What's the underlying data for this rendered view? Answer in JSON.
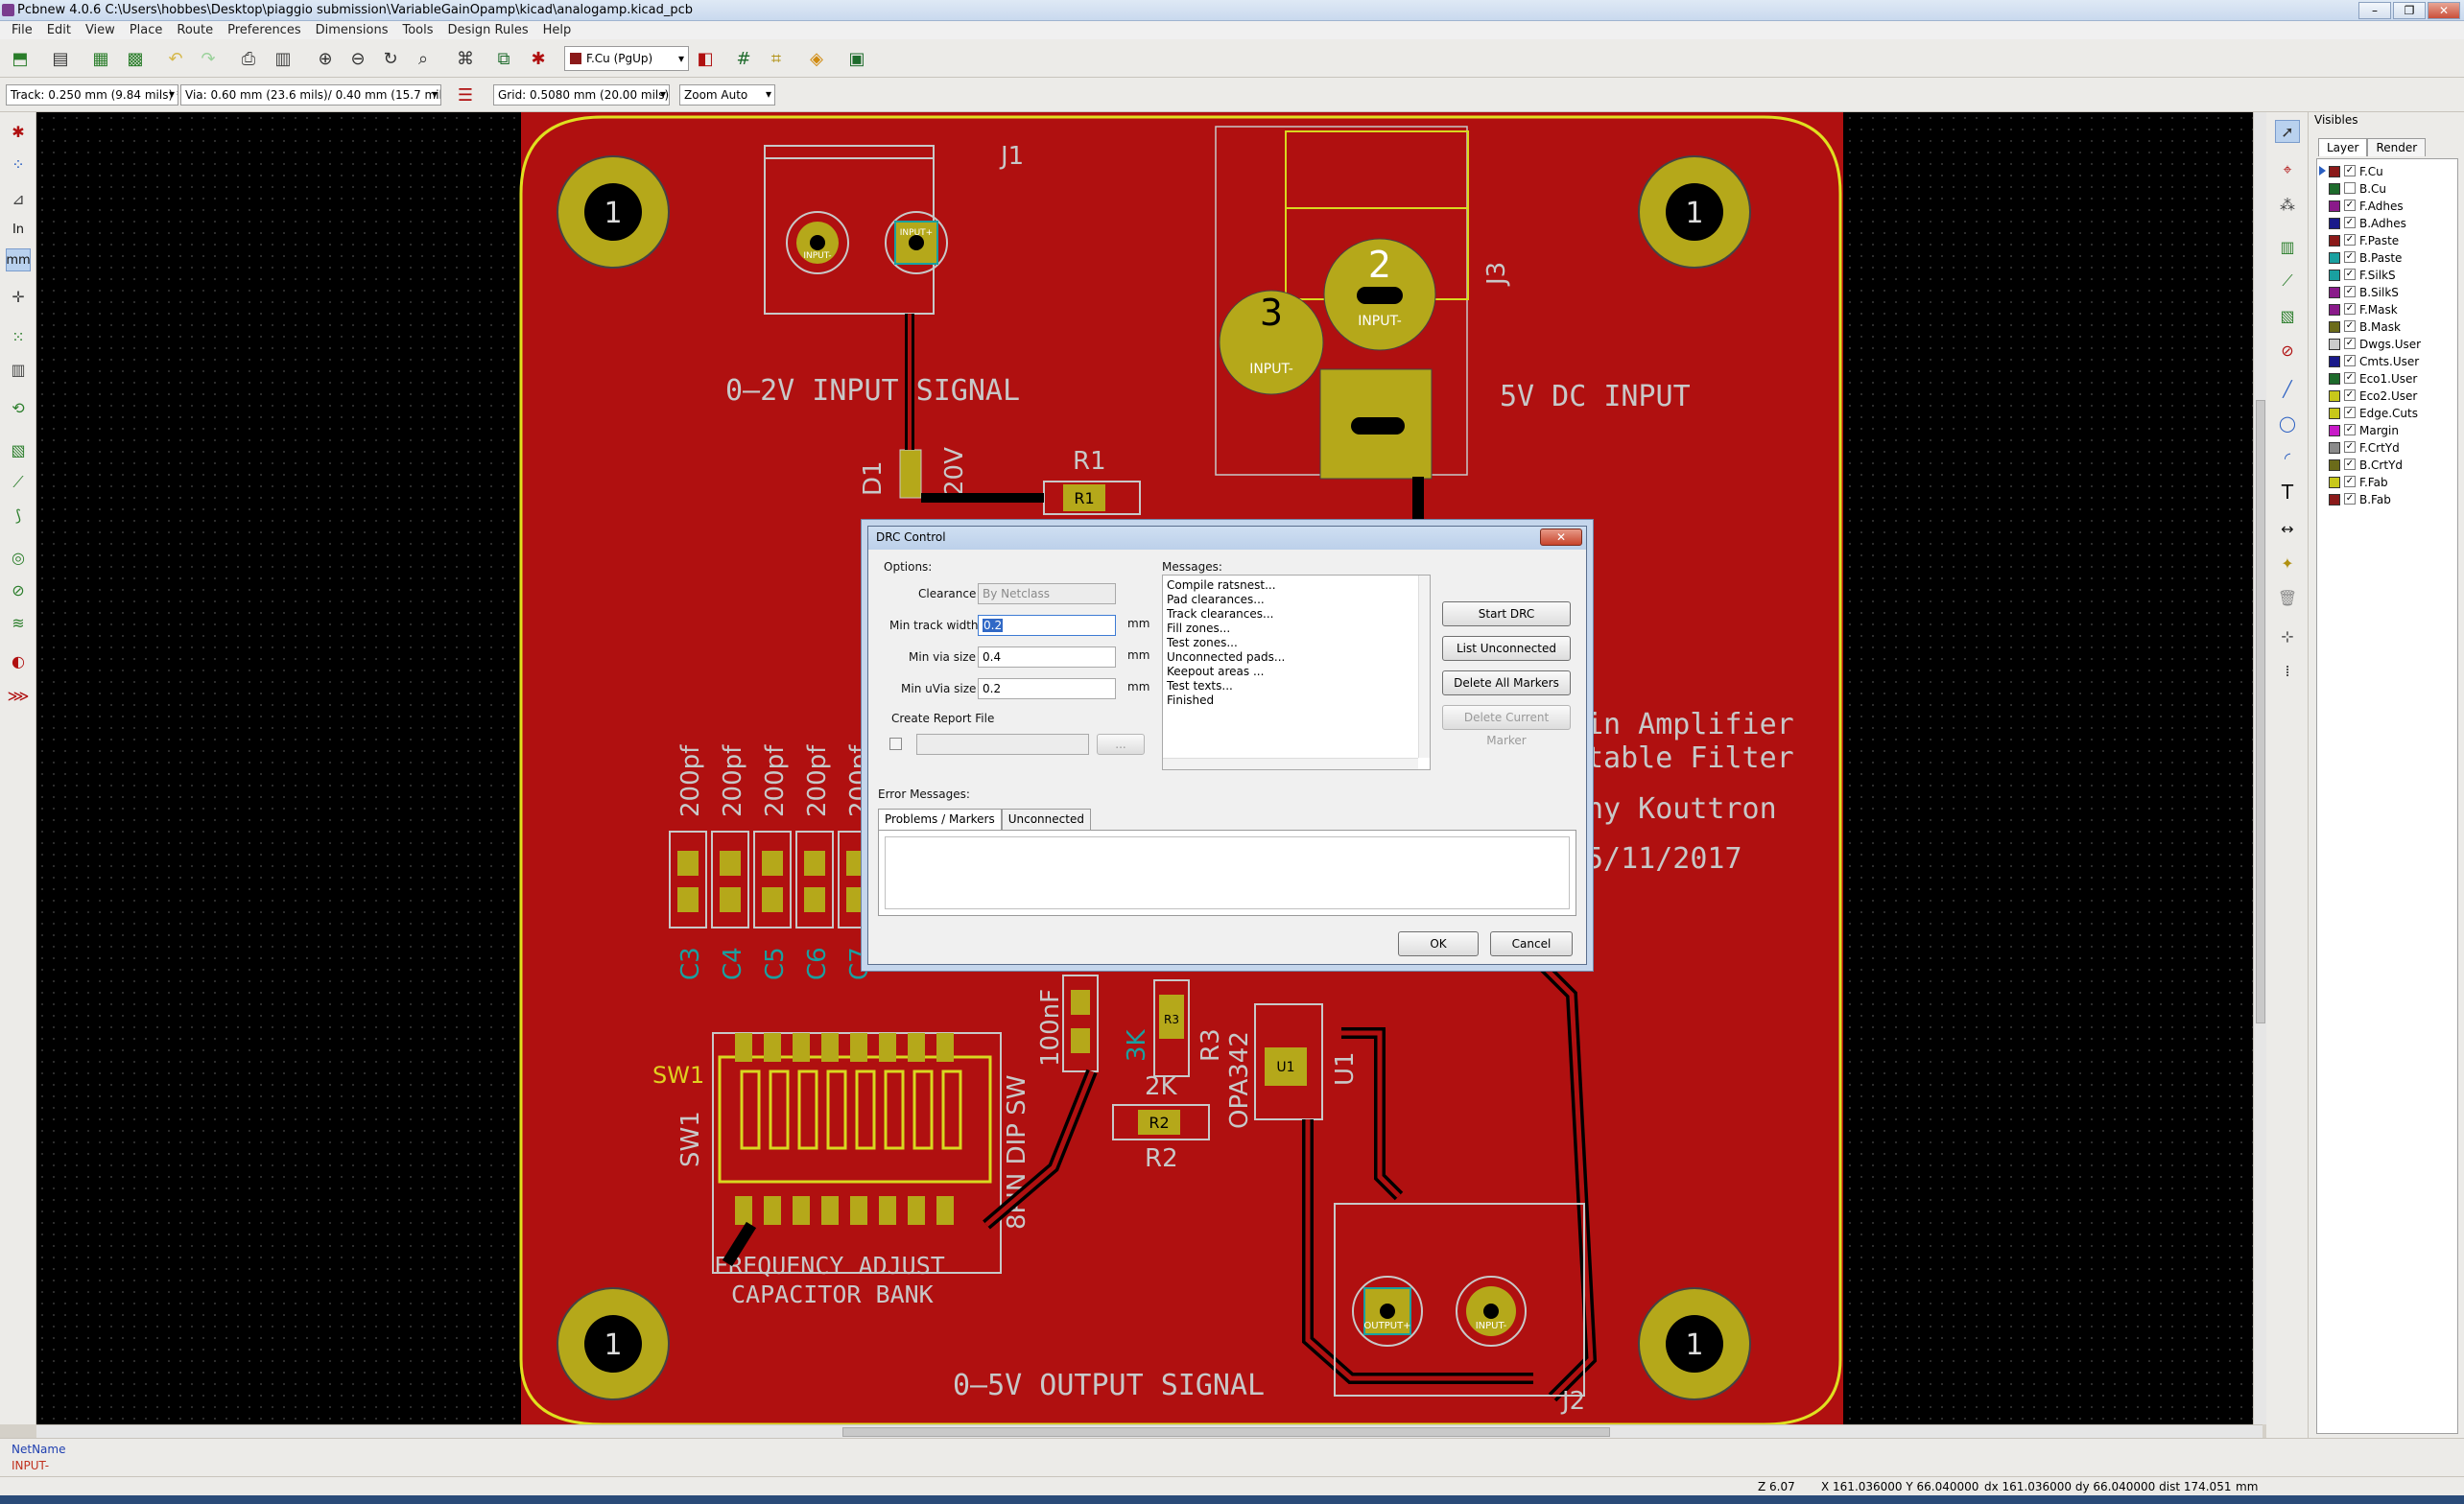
{
  "window": {
    "title": "Pcbnew 4.0.6 C:\\Users\\hobbes\\Desktop\\piaggio submission\\VariableGainOpamp\\kicad\\analogamp.kicad_pcb",
    "buttons": [
      "–",
      "❐",
      "✕"
    ]
  },
  "menu": [
    "File",
    "Edit",
    "View",
    "Place",
    "Route",
    "Preferences",
    "Dimensions",
    "Tools",
    "Design Rules",
    "Help"
  ],
  "toolbar": {
    "layer_select": "F.Cu (PgUp)",
    "track_combo": "Track: 0.250 mm (9.84 mils) *",
    "via_combo": "Via: 0.60 mm (23.6 mils)/ 0.40 mm (15.7 mils) *",
    "grid_combo": "Grid: 0.5080 mm (20.00 mils)",
    "zoom_combo": "Zoom Auto",
    "units_in": "In",
    "units_mm": "mm"
  },
  "pcb": {
    "labels": {
      "j1": "J1",
      "input_signal": "0–2V INPUT SIGNAL",
      "dc_input": "5V DC INPUT",
      "j3": "J3",
      "r1": "R1",
      "d1": "D1",
      "d1_val": "20V",
      "title1": "in Amplifier",
      "title2": "table Filter",
      "author": "hy Kouttron",
      "date": "5/11/2017",
      "sw1_yellow": "SW1",
      "sw1": "SW1",
      "dip_sw": "8PIN DIP SW",
      "freq1": "FREQUENCY ADJUST",
      "freq2": "CAPACITOR BANK",
      "output": "0–5V OUTPUT SIGNAL",
      "j2": "J2",
      "r2": "R2",
      "r2_val": "2K",
      "r3": "R3",
      "r3_val": "3K",
      "cap_val": "100nF",
      "u1": "U1",
      "u1_val": "OPA342",
      "pad_r1": "R1",
      "pad_r2": "R2",
      "pad_r3": "R3",
      "pad_u1": "U1",
      "pad_input_minus": "INPUT-",
      "pad_input_plus": "INPUT+",
      "pad_output_plus": "OUTPUT+",
      "pad_j3_input_minus": "INPUT-",
      "mount_hole": "1"
    },
    "cap_values": [
      "200pf",
      "200pf",
      "200pf",
      "200pf",
      "200pf"
    ],
    "cap_refs": [
      "C3",
      "C4",
      "C5",
      "C6",
      "C7"
    ],
    "pin_numbers": [
      "1",
      "2",
      "3"
    ]
  },
  "dialog": {
    "title": "DRC Control",
    "options_label": "Options:",
    "messages_label": "Messages:",
    "clearance_label": "Clearance",
    "clearance_value": "By Netclass",
    "min_track_label": "Min track width",
    "min_track_value": "0.2",
    "min_via_label": "Min via size",
    "min_via_value": "0.4",
    "min_uvia_label": "Min uVia size",
    "min_uvia_value": "0.2",
    "unit": "mm",
    "report_label": "Create Report File",
    "browse_label": "...",
    "messages": [
      "Compile ratsnest...",
      "Pad clearances...",
      "Track clearances...",
      "Fill zones...",
      "Test zones...",
      "Unconnected pads...",
      "Keepout areas ...",
      "Test texts...",
      "Finished"
    ],
    "start_drc": "Start DRC",
    "list_unconnected": "List Unconnected",
    "delete_all": "Delete All Markers",
    "delete_current": "Delete Current Marker",
    "error_messages_label": "Error Messages:",
    "tab_problems": "Problems / Markers",
    "tab_unconnected": "Unconnected",
    "ok": "OK",
    "cancel": "Cancel",
    "close": "✕"
  },
  "visibles": {
    "title": "Visibles",
    "tab_layer": "Layer",
    "tab_render": "Render",
    "layers": [
      {
        "name": "F.Cu",
        "color": "#8b1a1a",
        "checked": true
      },
      {
        "name": "B.Cu",
        "color": "#1e6b2c",
        "checked": false
      },
      {
        "name": "F.Adhes",
        "color": "#8a1a8a",
        "checked": true
      },
      {
        "name": "B.Adhes",
        "color": "#1a1a8a",
        "checked": true
      },
      {
        "name": "F.Paste",
        "color": "#8b1a1a",
        "checked": true
      },
      {
        "name": "B.Paste",
        "color": "#1aa0a0",
        "checked": true
      },
      {
        "name": "F.SilkS",
        "color": "#1aa0a0",
        "checked": true
      },
      {
        "name": "B.SilkS",
        "color": "#8a1a8a",
        "checked": true
      },
      {
        "name": "F.Mask",
        "color": "#8a1a8a",
        "checked": true
      },
      {
        "name": "B.Mask",
        "color": "#6b6b1a",
        "checked": true
      },
      {
        "name": "Dwgs.User",
        "color": "#cccccc",
        "checked": true
      },
      {
        "name": "Cmts.User",
        "color": "#1a1a8a",
        "checked": true
      },
      {
        "name": "Eco1.User",
        "color": "#1e6b2c",
        "checked": true
      },
      {
        "name": "Eco2.User",
        "color": "#c8c81a",
        "checked": true
      },
      {
        "name": "Edge.Cuts",
        "color": "#c8c81a",
        "checked": true
      },
      {
        "name": "Margin",
        "color": "#c81ac8",
        "checked": true
      },
      {
        "name": "F.CrtYd",
        "color": "#8a8a8a",
        "checked": true
      },
      {
        "name": "B.CrtYd",
        "color": "#6b6b1a",
        "checked": true
      },
      {
        "name": "F.Fab",
        "color": "#c8c81a",
        "checked": true
      },
      {
        "name": "B.Fab",
        "color": "#8b1a1a",
        "checked": true
      }
    ]
  },
  "msgpanel": {
    "label": "NetName",
    "value": "INPUT-"
  },
  "status": {
    "zoom": "Z 6.07",
    "xy": "X 161.036000  Y 66.040000",
    "dxdy": "dx 161.036000  dy 66.040000  dist 174.051",
    "units": "mm"
  },
  "colors": {
    "copper": "#b01010",
    "silk": "#c8c8c8",
    "pad": "#b5a81a",
    "edge": "#d8d820"
  }
}
